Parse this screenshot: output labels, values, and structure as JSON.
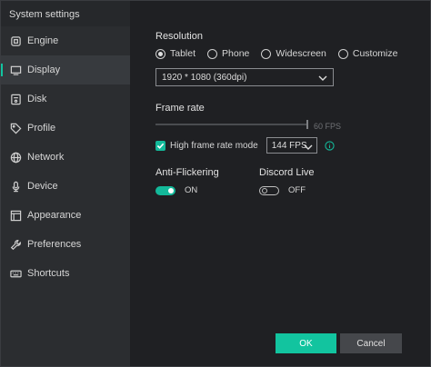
{
  "window": {
    "title": "System settings"
  },
  "sidebar": {
    "items": [
      {
        "label": "Engine",
        "icon": "engine-icon"
      },
      {
        "label": "Display",
        "icon": "monitor-icon",
        "active": true
      },
      {
        "label": "Disk",
        "icon": "disk-icon"
      },
      {
        "label": "Profile",
        "icon": "tag-icon"
      },
      {
        "label": "Network",
        "icon": "globe-icon"
      },
      {
        "label": "Device",
        "icon": "microphone-icon"
      },
      {
        "label": "Appearance",
        "icon": "appearance-icon"
      },
      {
        "label": "Preferences",
        "icon": "wrench-icon"
      },
      {
        "label": "Shortcuts",
        "icon": "keyboard-icon"
      }
    ]
  },
  "display": {
    "resolution": {
      "title": "Resolution",
      "options": [
        {
          "label": "Tablet",
          "checked": true
        },
        {
          "label": "Phone",
          "checked": false
        },
        {
          "label": "Widescreen",
          "checked": false
        },
        {
          "label": "Customize",
          "checked": false
        }
      ],
      "selected": "1920 * 1080 (360dpi)"
    },
    "frame_rate": {
      "title": "Frame rate",
      "slider_value_label": "60 FPS",
      "slider_level": 1.0,
      "high_frame_rate": {
        "label": "High frame rate mode",
        "checked": true,
        "value": "144 FPS"
      }
    },
    "anti_flickering": {
      "title": "Anti-Flickering",
      "state": "ON",
      "on": true
    },
    "discord_live": {
      "title": "Discord Live",
      "state": "OFF",
      "on": false
    }
  },
  "buttons": {
    "ok": "OK",
    "cancel": "Cancel"
  },
  "colors": {
    "accent": "#12c49f",
    "sidebar_bg": "#2b2d30",
    "main_bg": "#1f2023"
  }
}
